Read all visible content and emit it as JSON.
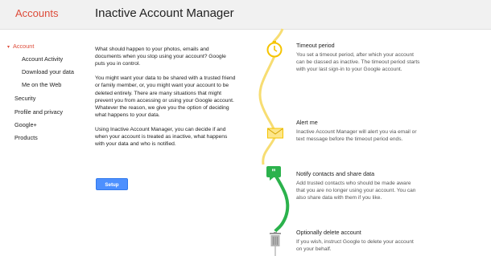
{
  "header": {
    "brand": "Accounts",
    "title": "Inactive Account Manager"
  },
  "sidebar": {
    "items": [
      {
        "label": "Account",
        "active": true,
        "expanded": true
      },
      {
        "label": "Account Activity"
      },
      {
        "label": "Download your data"
      },
      {
        "label": "Me on the Web"
      },
      {
        "label": "Security"
      },
      {
        "label": "Profile and privacy"
      },
      {
        "label": "Google+"
      },
      {
        "label": "Products"
      }
    ]
  },
  "intro": {
    "paragraphs": [
      "What should happen to your photos, emails and documents when you stop using your account? Google puts you in control.",
      "You might want your data to be shared with a trusted friend or family member, or, you might want your account to be deleted entirely. There are many situations that might prevent you from accessing or using your Google account. Whatever the reason, we give you the option of deciding what happens to your data.",
      "Using Inactive Account Manager, you can decide if and when your account is treated as inactive, what happens with your data and who is notified."
    ],
    "setup_label": "Setup"
  },
  "steps": [
    {
      "title": "Timeout period",
      "description": "You set a timeout period, after which your account can be classed as inactive. The timeout period starts with your last sign-in to your Google account.",
      "icon": "timer-icon"
    },
    {
      "title": "Alert me",
      "description": "Inactive Account Manager will alert you via email or text message before the timeout period ends.",
      "icon": "envelope-icon"
    },
    {
      "title": "Notify contacts and share data",
      "description": "Add trusted contacts who should be made aware that you are no longer using your account. You can also share data with them if you like.",
      "icon": "quote-bubble-icon"
    },
    {
      "title": "Optionally delete account",
      "description": "If you wish, instruct Google to delete your account on your behalf.",
      "icon": "trash-icon"
    }
  ],
  "colors": {
    "brand": "#dd4b39",
    "button": "#4d90fe",
    "timeline_yellow": "#f7dd72",
    "timeline_green": "#2bb24c",
    "timeline_grey": "#cccccc"
  }
}
